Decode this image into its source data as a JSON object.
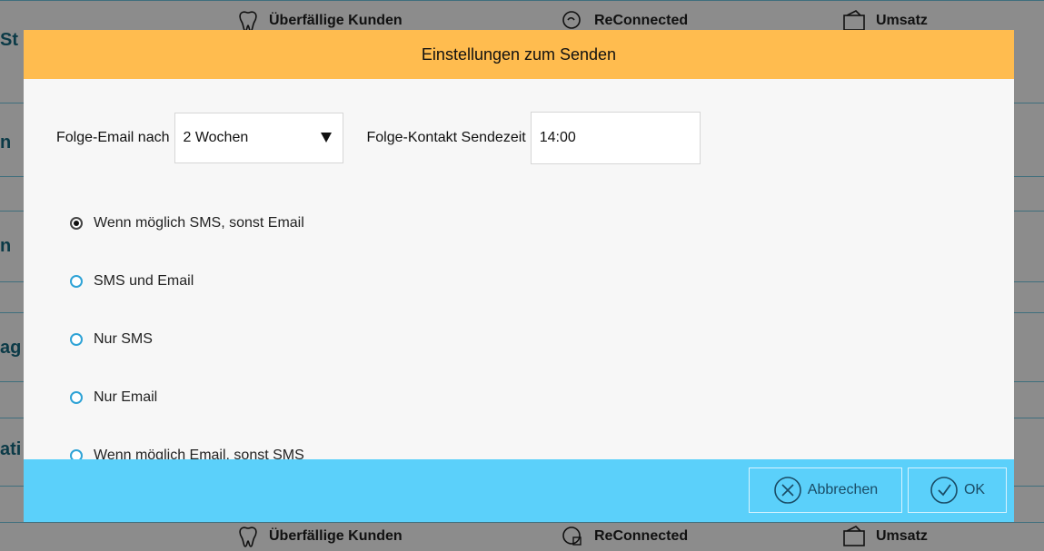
{
  "background": {
    "tabs": [
      "Überfällige Kunden",
      "ReConnected",
      "Umsatz"
    ],
    "side_fragments": [
      "St",
      "n",
      "n",
      "ag",
      "ati"
    ]
  },
  "dialog": {
    "title": "Einstellungen zum Senden",
    "followup_label": "Folge-Email nach",
    "followup_value": "2 Wochen",
    "sendtime_label": "Folge-Kontakt Sendezeit",
    "sendtime_value": "14:00",
    "options": [
      {
        "label": "Wenn möglich SMS, sonst Email",
        "checked": true
      },
      {
        "label": "SMS und Email",
        "checked": false
      },
      {
        "label": "Nur SMS",
        "checked": false
      },
      {
        "label": "Nur Email",
        "checked": false
      },
      {
        "label": "Wenn möglich Email, sonst SMS",
        "checked": false
      }
    ],
    "cancel_label": "Abbrechen",
    "ok_label": "OK"
  },
  "colors": {
    "header": "#ffbc4f",
    "footer": "#5bd0fa",
    "radio": "#2fa3d6"
  }
}
